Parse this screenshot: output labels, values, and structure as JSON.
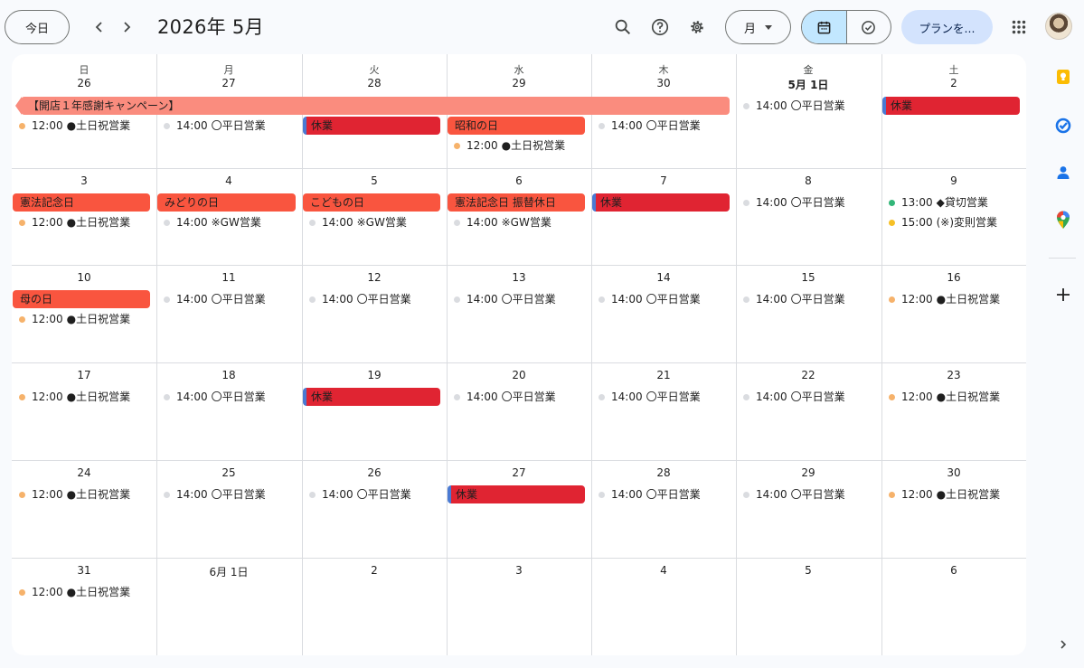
{
  "toolbar": {
    "today_label": "今日",
    "title": "2026年 5月",
    "view_label": "月",
    "plan_label": "プランを..."
  },
  "icons": {
    "prev": "chevron-left-icon",
    "next": "chevron-right-icon",
    "search": "search-icon",
    "help": "help-icon",
    "settings": "gear-icon",
    "calendar_view": "calendar-icon",
    "tasks_view": "check-circle-icon",
    "apps": "apps-grid-icon"
  },
  "colors": {
    "holiday": "#f9553f",
    "closed": "#e02432",
    "campaign": "#fa8c7e",
    "weekday_dot": "#dadce0",
    "weekend_dot": "#f6b26b",
    "charter_dot": "#33b679",
    "special_dot": "#f6c026",
    "selected_view": "#c2e7ff"
  },
  "weekdays": [
    "日",
    "月",
    "火",
    "水",
    "木",
    "金",
    "土"
  ],
  "weeks": [
    {
      "days": [
        {
          "label": "26"
        },
        {
          "label": "27"
        },
        {
          "label": "28"
        },
        {
          "label": "29"
        },
        {
          "label": "30"
        },
        {
          "label": "5月 1日",
          "bold": true
        },
        {
          "label": "2"
        }
      ],
      "spans": [
        {
          "col": 0,
          "span": 5,
          "row": 0,
          "kind": "pink",
          "text": "【開店１年感謝キャンペーン】",
          "continues_left": true
        },
        {
          "col": 2,
          "span": 1,
          "row": 1,
          "kind": "red",
          "text": "休業"
        },
        {
          "col": 3,
          "span": 1,
          "row": 1,
          "kind": "orange",
          "text": "昭和の日"
        },
        {
          "col": 6,
          "span": 1,
          "row": 0,
          "kind": "red",
          "text": "休業"
        }
      ],
      "events": [
        {
          "col": 0,
          "row": 1,
          "dot": "weekend",
          "time": "12:00",
          "text": "●土日祝営業"
        },
        {
          "col": 1,
          "row": 1,
          "dot": "weekday",
          "time": "14:00",
          "text": "〇平日営業"
        },
        {
          "col": 3,
          "row": 2,
          "dot": "weekend",
          "time": "12:00",
          "text": "●土日祝営業"
        },
        {
          "col": 4,
          "row": 1,
          "dot": "weekday",
          "time": "14:00",
          "text": "〇平日営業"
        },
        {
          "col": 5,
          "row": 0,
          "dot": "weekday",
          "time": "14:00",
          "text": "〇平日営業"
        }
      ]
    },
    {
      "days": [
        {
          "label": "3"
        },
        {
          "label": "4"
        },
        {
          "label": "5"
        },
        {
          "label": "6"
        },
        {
          "label": "7"
        },
        {
          "label": "8"
        },
        {
          "label": "9"
        }
      ],
      "spans": [
        {
          "col": 0,
          "span": 1,
          "row": 0,
          "kind": "orange",
          "text": "憲法記念日"
        },
        {
          "col": 1,
          "span": 1,
          "row": 0,
          "kind": "orange",
          "text": "みどりの日"
        },
        {
          "col": 2,
          "span": 1,
          "row": 0,
          "kind": "orange",
          "text": "こどもの日"
        },
        {
          "col": 3,
          "span": 1,
          "row": 0,
          "kind": "orange",
          "text": "憲法記念日 振替休日"
        },
        {
          "col": 4,
          "span": 1,
          "row": 0,
          "kind": "red",
          "text": "休業"
        }
      ],
      "events": [
        {
          "col": 0,
          "row": 1,
          "dot": "weekend",
          "time": "12:00",
          "text": "●土日祝営業"
        },
        {
          "col": 1,
          "row": 1,
          "dot": "weekday",
          "time": "14:00",
          "text": "※GW営業"
        },
        {
          "col": 2,
          "row": 1,
          "dot": "weekday",
          "time": "14:00",
          "text": "※GW営業"
        },
        {
          "col": 3,
          "row": 1,
          "dot": "weekday",
          "time": "14:00",
          "text": "※GW営業"
        },
        {
          "col": 5,
          "row": 0,
          "dot": "weekday",
          "time": "14:00",
          "text": "〇平日営業"
        },
        {
          "col": 6,
          "row": 0,
          "dot": "charter",
          "time": "13:00",
          "text": "◆貸切営業"
        },
        {
          "col": 6,
          "row": 1,
          "dot": "special",
          "time": "15:00",
          "text": "(※)変則営業"
        }
      ]
    },
    {
      "days": [
        {
          "label": "10"
        },
        {
          "label": "11"
        },
        {
          "label": "12"
        },
        {
          "label": "13"
        },
        {
          "label": "14"
        },
        {
          "label": "15"
        },
        {
          "label": "16"
        }
      ],
      "spans": [
        {
          "col": 0,
          "span": 1,
          "row": 0,
          "kind": "orange",
          "text": "母の日"
        }
      ],
      "events": [
        {
          "col": 0,
          "row": 1,
          "dot": "weekend",
          "time": "12:00",
          "text": "●土日祝営業"
        },
        {
          "col": 1,
          "row": 0,
          "dot": "weekday",
          "time": "14:00",
          "text": "〇平日営業"
        },
        {
          "col": 2,
          "row": 0,
          "dot": "weekday",
          "time": "14:00",
          "text": "〇平日営業"
        },
        {
          "col": 3,
          "row": 0,
          "dot": "weekday",
          "time": "14:00",
          "text": "〇平日営業"
        },
        {
          "col": 4,
          "row": 0,
          "dot": "weekday",
          "time": "14:00",
          "text": "〇平日営業"
        },
        {
          "col": 5,
          "row": 0,
          "dot": "weekday",
          "time": "14:00",
          "text": "〇平日営業"
        },
        {
          "col": 6,
          "row": 0,
          "dot": "weekend",
          "time": "12:00",
          "text": "●土日祝営業"
        }
      ]
    },
    {
      "days": [
        {
          "label": "17"
        },
        {
          "label": "18"
        },
        {
          "label": "19"
        },
        {
          "label": "20"
        },
        {
          "label": "21"
        },
        {
          "label": "22"
        },
        {
          "label": "23"
        }
      ],
      "spans": [
        {
          "col": 2,
          "span": 1,
          "row": 0,
          "kind": "red",
          "text": "休業"
        }
      ],
      "events": [
        {
          "col": 0,
          "row": 0,
          "dot": "weekend",
          "time": "12:00",
          "text": "●土日祝営業"
        },
        {
          "col": 1,
          "row": 0,
          "dot": "weekday",
          "time": "14:00",
          "text": "〇平日営業"
        },
        {
          "col": 3,
          "row": 0,
          "dot": "weekday",
          "time": "14:00",
          "text": "〇平日営業"
        },
        {
          "col": 4,
          "row": 0,
          "dot": "weekday",
          "time": "14:00",
          "text": "〇平日営業"
        },
        {
          "col": 5,
          "row": 0,
          "dot": "weekday",
          "time": "14:00",
          "text": "〇平日営業"
        },
        {
          "col": 6,
          "row": 0,
          "dot": "weekend",
          "time": "12:00",
          "text": "●土日祝営業"
        }
      ]
    },
    {
      "days": [
        {
          "label": "24"
        },
        {
          "label": "25"
        },
        {
          "label": "26"
        },
        {
          "label": "27"
        },
        {
          "label": "28"
        },
        {
          "label": "29"
        },
        {
          "label": "30"
        }
      ],
      "spans": [
        {
          "col": 3,
          "span": 1,
          "row": 0,
          "kind": "red",
          "text": "休業"
        }
      ],
      "events": [
        {
          "col": 0,
          "row": 0,
          "dot": "weekend",
          "time": "12:00",
          "text": "●土日祝営業"
        },
        {
          "col": 1,
          "row": 0,
          "dot": "weekday",
          "time": "14:00",
          "text": "〇平日営業"
        },
        {
          "col": 2,
          "row": 0,
          "dot": "weekday",
          "time": "14:00",
          "text": "〇平日営業"
        },
        {
          "col": 4,
          "row": 0,
          "dot": "weekday",
          "time": "14:00",
          "text": "〇平日営業"
        },
        {
          "col": 5,
          "row": 0,
          "dot": "weekday",
          "time": "14:00",
          "text": "〇平日営業"
        },
        {
          "col": 6,
          "row": 0,
          "dot": "weekend",
          "time": "12:00",
          "text": "●土日祝営業"
        }
      ]
    },
    {
      "days": [
        {
          "label": "31"
        },
        {
          "label": "6月 1日"
        },
        {
          "label": "2"
        },
        {
          "label": "3"
        },
        {
          "label": "4"
        },
        {
          "label": "5"
        },
        {
          "label": "6"
        }
      ],
      "spans": [],
      "events": [
        {
          "col": 0,
          "row": 0,
          "dot": "weekend",
          "time": "12:00",
          "text": "●土日祝営業"
        }
      ]
    }
  ],
  "side_panel": [
    "keep-icon",
    "tasks-icon",
    "contacts-icon",
    "maps-icon",
    "add-icon",
    "expand-panel-icon"
  ]
}
